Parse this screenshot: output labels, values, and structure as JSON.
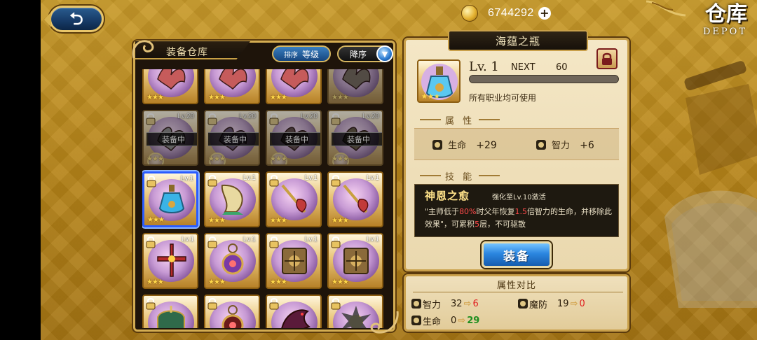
{
  "header": {
    "back_label": "⮌",
    "gold": "6744292",
    "gold_plus": "+",
    "title_cn": "仓库",
    "title_en": "DEPOT"
  },
  "inventory": {
    "title": "装备仓库",
    "sort_prefix": "排序",
    "sort_label": "等级",
    "order_label": "降序",
    "order_arrow": "▼",
    "equipped_label": "装备中",
    "items": [
      {
        "level": "",
        "stars": "★★★",
        "locked": false,
        "equipped": false,
        "dim": false,
        "hue": "#c65b5b",
        "shape": "wing"
      },
      {
        "level": "",
        "stars": "★★★",
        "locked": false,
        "equipped": false,
        "dim": false,
        "hue": "#c65b5b",
        "shape": "wing"
      },
      {
        "level": "",
        "stars": "★★★",
        "locked": false,
        "equipped": false,
        "dim": false,
        "hue": "#c65b5b",
        "shape": "wing"
      },
      {
        "level": "",
        "stars": "★★★",
        "locked": false,
        "equipped": false,
        "dim": true,
        "hue": "#7a6a5a",
        "shape": "wing"
      },
      {
        "level": "Lv.20",
        "stars": "★★★",
        "locked": true,
        "equipped": true,
        "dim": true,
        "hue": "#8a8a8a",
        "shape": "wing"
      },
      {
        "level": "Lv.20",
        "stars": "★★★",
        "locked": true,
        "equipped": true,
        "dim": true,
        "hue": "#6d5080",
        "shape": "wing"
      },
      {
        "level": "Lv.20",
        "stars": "★★★",
        "locked": true,
        "equipped": true,
        "dim": true,
        "hue": "#6a4a4a",
        "shape": "wing"
      },
      {
        "level": "Lv.20",
        "stars": "★★★",
        "locked": true,
        "equipped": true,
        "dim": true,
        "hue": "#6a5a3a",
        "shape": "wing"
      },
      {
        "level": "Lv.1",
        "stars": "★★★",
        "locked": true,
        "equipped": false,
        "dim": false,
        "hue": "#3ab3e6",
        "shape": "bottle",
        "selected": true
      },
      {
        "level": "Lv.1",
        "stars": "★★★",
        "locked": true,
        "equipped": false,
        "dim": false,
        "hue": "#3aa66a",
        "shape": "harp"
      },
      {
        "level": "Lv.1",
        "stars": "★★★",
        "locked": true,
        "equipped": false,
        "dim": false,
        "hue": "#c23a3a",
        "shape": "staff"
      },
      {
        "level": "Lv.1",
        "stars": "★★★",
        "locked": true,
        "equipped": false,
        "dim": false,
        "hue": "#c23a3a",
        "shape": "staff"
      },
      {
        "level": "Lv.1",
        "stars": "★★★",
        "locked": true,
        "equipped": false,
        "dim": false,
        "hue": "#b52a2a",
        "shape": "cross"
      },
      {
        "level": "Lv.1",
        "stars": "★★★",
        "locked": true,
        "equipped": false,
        "dim": false,
        "hue": "#7a3aa6",
        "shape": "amulet"
      },
      {
        "level": "Lv.1",
        "stars": "★★★",
        "locked": true,
        "equipped": false,
        "dim": false,
        "hue": "#8a6a3a",
        "shape": "book"
      },
      {
        "level": "Lv.1",
        "stars": "★★★",
        "locked": true,
        "equipped": false,
        "dim": false,
        "hue": "#8a6a3a",
        "shape": "book"
      },
      {
        "level": "",
        "stars": "",
        "locked": true,
        "equipped": false,
        "dim": false,
        "hue": "#2f6a4a",
        "shape": "chest"
      },
      {
        "level": "",
        "stars": "",
        "locked": true,
        "equipped": false,
        "dim": false,
        "hue": "#6a1a1a",
        "shape": "amulet"
      },
      {
        "level": "",
        "stars": "",
        "locked": true,
        "equipped": false,
        "dim": false,
        "hue": "#5a1a3a",
        "shape": "dragon"
      },
      {
        "level": "",
        "stars": "",
        "locked": true,
        "equipped": false,
        "dim": false,
        "hue": "#3a3a3a",
        "shape": "flower"
      }
    ]
  },
  "detail": {
    "name": "海蕴之瓶",
    "level": "Lv. 1",
    "next_label": "NEXT",
    "next_value": "60",
    "xp_fraction": 0,
    "usable": "所有职业均可使用",
    "stars": "★★★",
    "attr_section": "属 性",
    "attrs": [
      {
        "name": "生命",
        "value": "+29"
      },
      {
        "name": "智力",
        "value": "+6"
      }
    ],
    "skill_section": "技 能",
    "skill_name": "神恩之愈",
    "skill_req": "强化至Lv.10激活",
    "skill_desc_1": "\"主师低于",
    "skill_desc_red1": "80%",
    "skill_desc_2": "时父年恢复",
    "skill_desc_red2": "1.5",
    "skill_desc_3": "倍智力的生命，并移除此效果\"，可累积",
    "skill_desc_red3": "5",
    "skill_desc_4": "层，不可驱散",
    "equip_label": "装备"
  },
  "compare": {
    "title": "属性对比",
    "rows": [
      {
        "name": "智力",
        "old": "32",
        "new": "6",
        "dir": "down"
      },
      {
        "name": "魔防",
        "old": "19",
        "new": "0",
        "dir": "down"
      },
      {
        "name": "生命",
        "old": "0",
        "new": "29",
        "dir": "up"
      }
    ],
    "arrow": "⇨"
  },
  "colors": {
    "accent_gold": "#c9a04a",
    "button_blue": "#2b86e0",
    "stat_down": "#e02020",
    "stat_up": "#1f8e1f"
  }
}
